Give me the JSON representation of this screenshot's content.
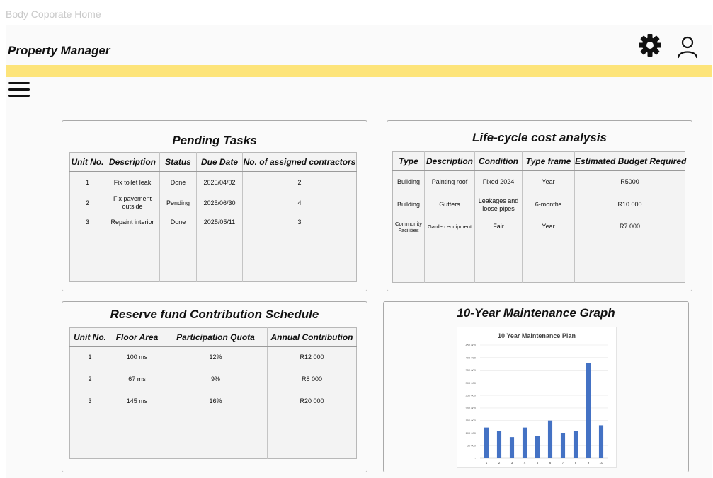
{
  "page": {
    "doc_title": "Body Coporate Home",
    "app_title": "Property Manager"
  },
  "header": {
    "settings_icon": "gear-icon",
    "profile_icon": "user-icon",
    "menu_icon": "hamburger-icon",
    "accent_color": "#fde47a"
  },
  "pending_tasks": {
    "title": "Pending Tasks",
    "columns": [
      "Unit No.",
      "Description",
      "Status",
      "Due Date",
      "No. of assigned contractors"
    ],
    "rows": [
      [
        "1",
        "Fix toilet leak",
        "Done",
        "2025/04/02",
        "2"
      ],
      [
        "2",
        "Fix pavement outside",
        "Pending",
        "2025/06/30",
        "4"
      ],
      [
        "3",
        "Repaint interior",
        "Done",
        "2025/05/11",
        "3"
      ]
    ]
  },
  "lifecycle": {
    "title": "Life-cycle cost analysis",
    "columns": [
      "Type",
      "Description",
      "Condition",
      "Type frame",
      "Estimated Budget Required"
    ],
    "rows": [
      [
        "Building",
        "Painting roof",
        "Fixed 2024",
        "Year",
        "R5000"
      ],
      [
        "Building",
        "Gutters",
        "Leakages and loose pipes",
        "6-months",
        "R10 000"
      ],
      [
        "Community Facilities",
        "Garden equipment",
        "Fair",
        "Year",
        "R7 000"
      ]
    ]
  },
  "reserve_fund": {
    "title": "Reserve fund Contribution Schedule",
    "columns": [
      "Unit No.",
      "Floor Area",
      "Participation Quota",
      "Annual Contribution"
    ],
    "rows": [
      [
        "1",
        "100 ms",
        "12%",
        "R12 000"
      ],
      [
        "2",
        "67 ms",
        "9%",
        "R8 000"
      ],
      [
        "3",
        "145 ms",
        "16%",
        "R20 000"
      ]
    ]
  },
  "maintenance_graph": {
    "title": "10-Year Maintenance Graph",
    "chart_data": {
      "type": "bar",
      "title": "10 Year Maintenance Plan",
      "categories": [
        "1",
        "2",
        "3",
        "4",
        "5",
        "6",
        "7",
        "8",
        "9",
        "10"
      ],
      "values": [
        122000,
        108000,
        84000,
        122000,
        89000,
        150000,
        99000,
        108000,
        378000,
        131000
      ],
      "ylim": [
        0,
        450000
      ],
      "yticks": [
        "-",
        "50 000",
        "100 000",
        "150 000",
        "200 000",
        "250 000",
        "300 000",
        "350 000",
        "400 000",
        "450 000"
      ],
      "bar_color": "#4472c4",
      "grid": true
    }
  }
}
